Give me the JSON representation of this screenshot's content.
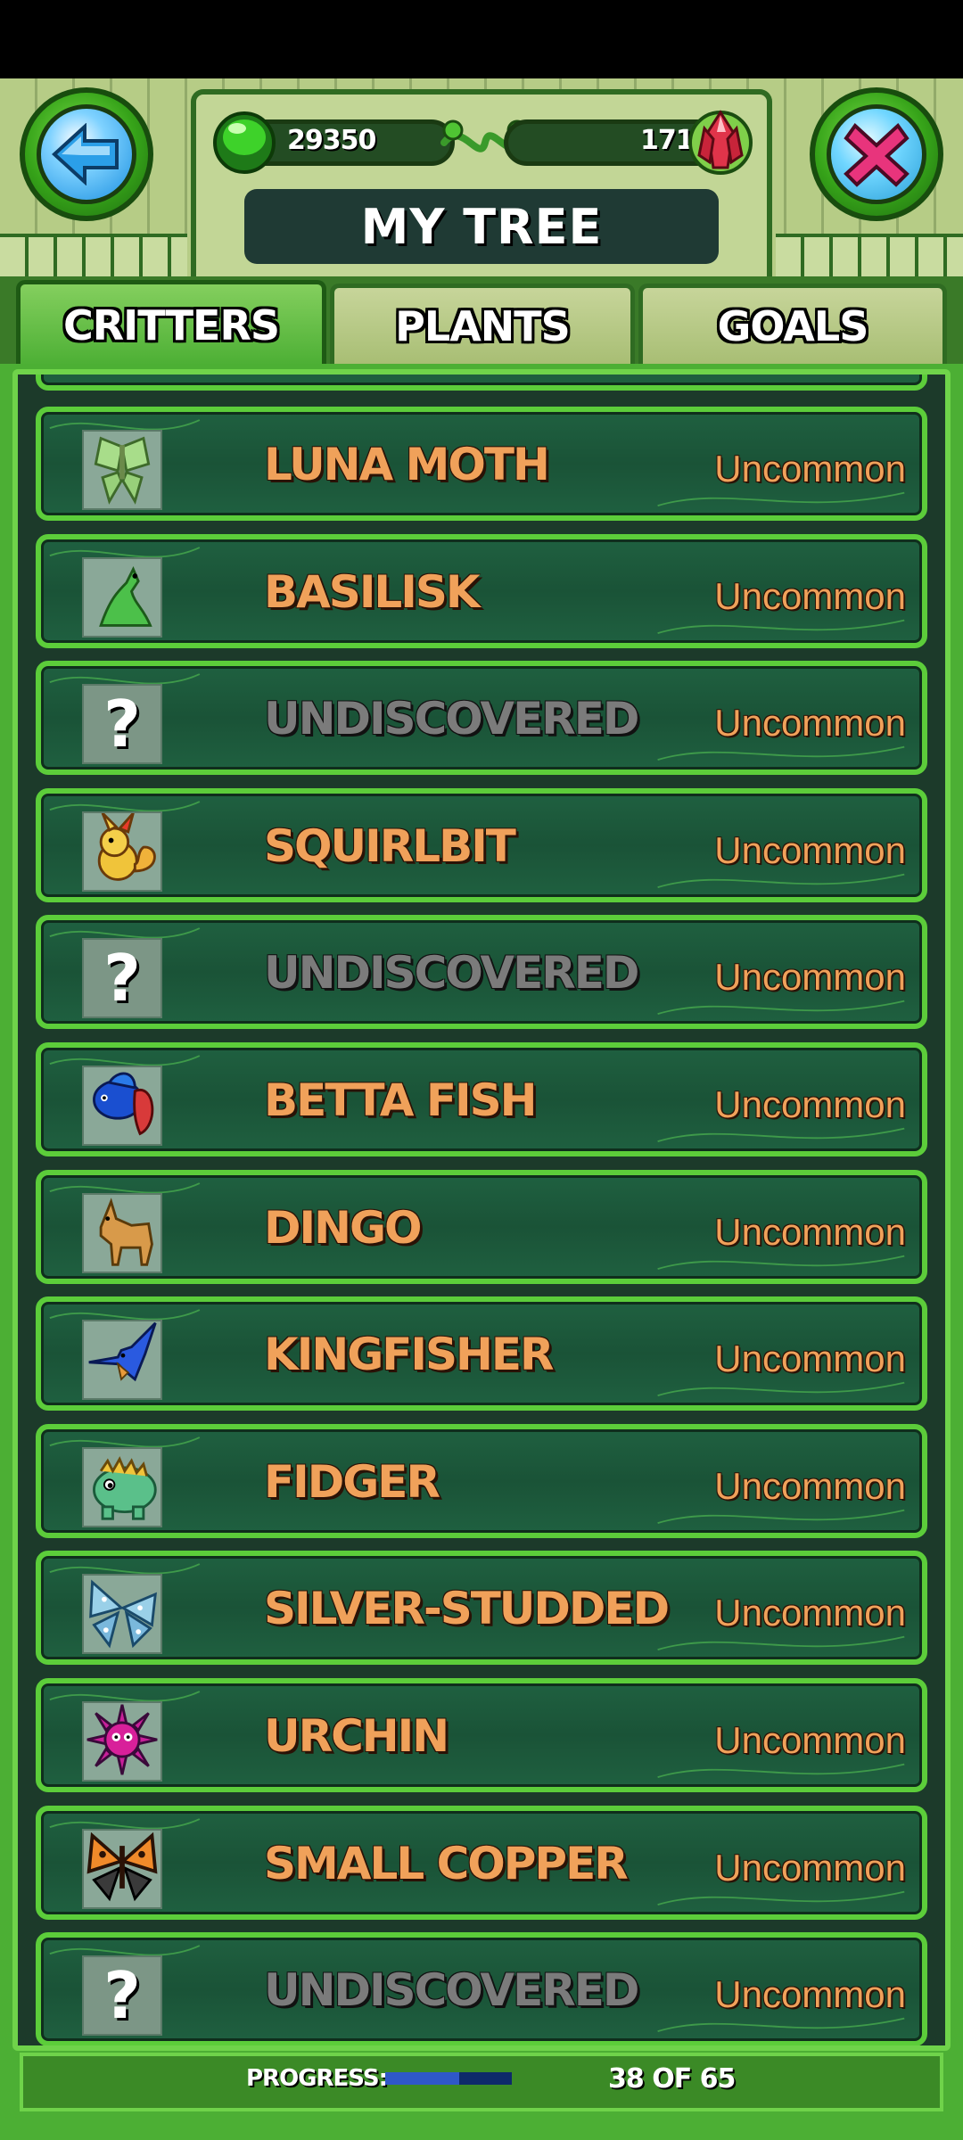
{
  "header": {
    "title": "MY TREE",
    "gems": "29350",
    "crystals": "171",
    "back_icon": "back-arrow-icon",
    "close_icon": "close-x-icon"
  },
  "tabs": [
    {
      "label": "CRITTERS",
      "active": true
    },
    {
      "label": "PLANTS",
      "active": false
    },
    {
      "label": "GOALS",
      "active": false
    }
  ],
  "critters": [
    {
      "name": "LUNA MOTH",
      "rarity": "Uncommon",
      "icon": "luna-moth-icon",
      "discovered": true
    },
    {
      "name": "BASILISK",
      "rarity": "Uncommon",
      "icon": "basilisk-icon",
      "discovered": true
    },
    {
      "name": "UNDISCOVERED",
      "rarity": "Uncommon",
      "icon": "question-mark-icon",
      "discovered": false
    },
    {
      "name": "SQUIRLBIT",
      "rarity": "Uncommon",
      "icon": "squirlbit-icon",
      "discovered": true
    },
    {
      "name": "UNDISCOVERED",
      "rarity": "Uncommon",
      "icon": "question-mark-icon",
      "discovered": false
    },
    {
      "name": "BETTA FISH",
      "rarity": "Uncommon",
      "icon": "betta-fish-icon",
      "discovered": true
    },
    {
      "name": "DINGO",
      "rarity": "Uncommon",
      "icon": "dingo-icon",
      "discovered": true
    },
    {
      "name": "KINGFISHER",
      "rarity": "Uncommon",
      "icon": "kingfisher-icon",
      "discovered": true
    },
    {
      "name": "FIDGER",
      "rarity": "Uncommon",
      "icon": "fidger-icon",
      "discovered": true
    },
    {
      "name": "SILVER-STUDDED",
      "rarity": "Uncommon",
      "icon": "silver-studded-icon",
      "discovered": true
    },
    {
      "name": "URCHIN",
      "rarity": "Uncommon",
      "icon": "urchin-icon",
      "discovered": true
    },
    {
      "name": "SMALL COPPER",
      "rarity": "Uncommon",
      "icon": "small-copper-icon",
      "discovered": true
    },
    {
      "name": "UNDISCOVERED",
      "rarity": "Uncommon",
      "icon": "question-mark-icon",
      "discovered": false
    }
  ],
  "progress": {
    "label": "PROGRESS:",
    "count_text": "38 OF 65",
    "fraction": 0.585
  },
  "colors": {
    "frame_green": "#4caf34",
    "row_border": "#5ccd3a",
    "row_bg": "#1a5337",
    "name_orange": "#f0a15a",
    "undiscovered_gray": "#7b7b7b",
    "progress_fill": "#2f58c8"
  }
}
